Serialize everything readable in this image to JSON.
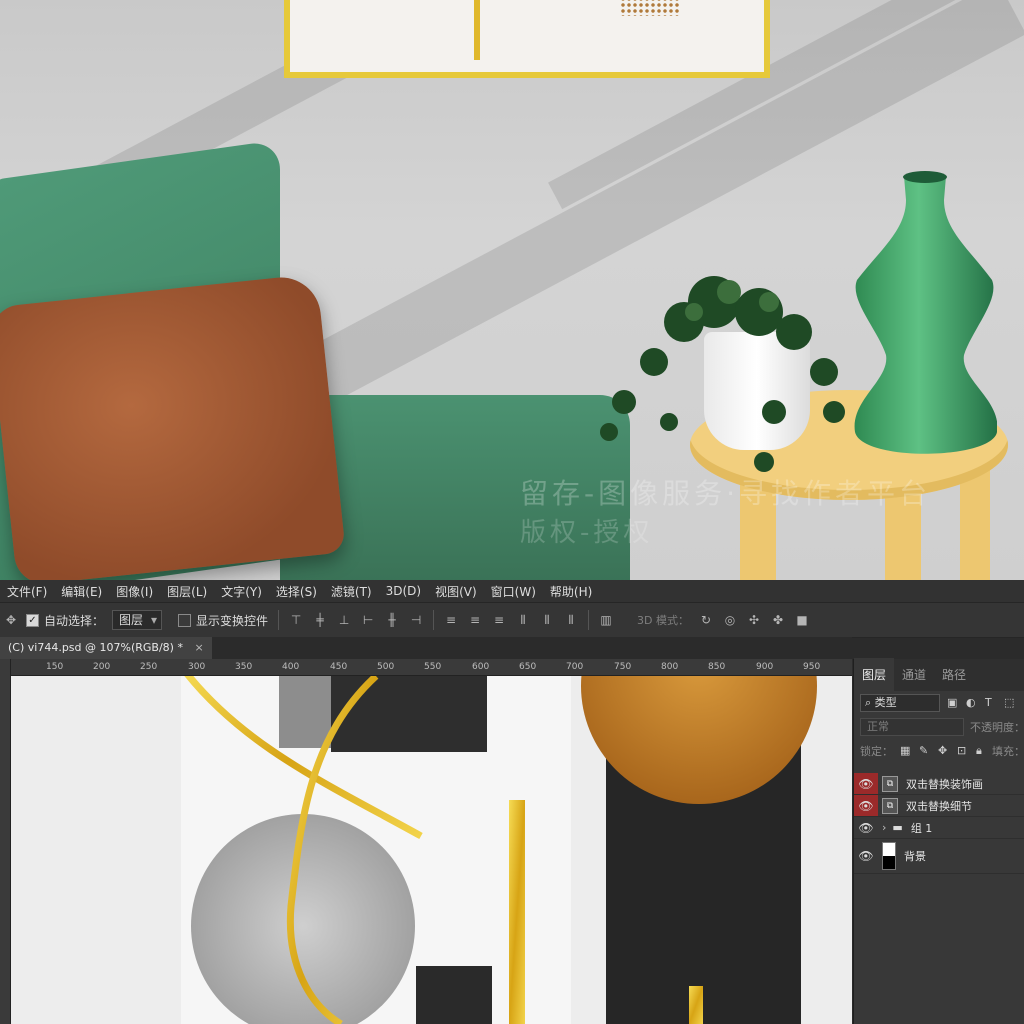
{
  "menu": {
    "items": [
      "文件(F)",
      "编辑(E)",
      "图像(I)",
      "图层(L)",
      "文字(Y)",
      "选择(S)",
      "滤镜(T)",
      "3D(D)",
      "视图(V)",
      "窗口(W)",
      "帮助(H)"
    ]
  },
  "options": {
    "auto_select_label": "自动选择：",
    "auto_select_value": "图层",
    "show_transform_label": "显示变换控件",
    "mode_3d_label": "3D 模式："
  },
  "document": {
    "tab_title": "(C) vi744.psd @ 107%(RGB/8) *",
    "close_glyph": "×"
  },
  "ruler": {
    "h_labels": [
      "150",
      "200",
      "250",
      "300",
      "350",
      "400",
      "450",
      "500",
      "550",
      "600",
      "650",
      "700",
      "750",
      "800",
      "850",
      "900",
      "950"
    ]
  },
  "scene": {
    "watermark_line1": "留存-图像服务·寻找作者平台",
    "watermark_line2": "版权-授权"
  },
  "layers_panel": {
    "tabs": [
      "图层",
      "通道",
      "路径"
    ],
    "filter_label": "类型",
    "blend_mode": "正常",
    "opacity_label": "不透明度：",
    "lock_label": "锁定：",
    "fill_label": "填充：",
    "layers": [
      {
        "name": "双击替换装饰画",
        "visible": true,
        "highlighted": true,
        "kind": "smart"
      },
      {
        "name": "双击替换细节",
        "visible": true,
        "highlighted": true,
        "kind": "smart"
      },
      {
        "name": "组 1",
        "visible": true,
        "highlighted": false,
        "kind": "group"
      },
      {
        "name": "背景",
        "visible": true,
        "highlighted": false,
        "kind": "background"
      }
    ]
  },
  "colors": {
    "accent_gold": "#e6c93a",
    "sofa_green": "#4b9271",
    "eye_highlight": "#9b2a2a"
  }
}
